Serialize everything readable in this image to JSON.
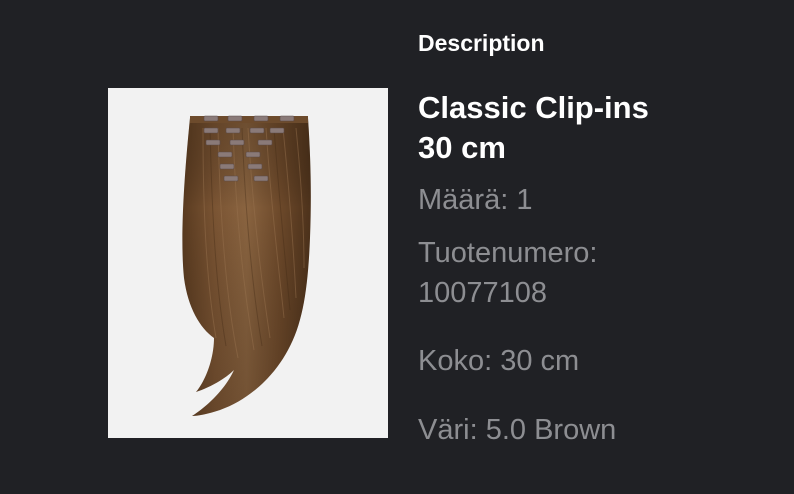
{
  "description_heading": "Description",
  "product": {
    "title_line1": "Classic Clip-ins",
    "title_line2": "30 cm",
    "image_alt": "Brown clip-in hair extensions"
  },
  "attributes": {
    "quantity_label": "Määrä:",
    "quantity_value": "1",
    "sku_label": "Tuotenumero:",
    "sku_value": "10077108",
    "size_label": "Koko:",
    "size_value": "30 cm",
    "color_label": "Väri:",
    "color_value": "5.0 Brown"
  },
  "colors": {
    "background": "#202125",
    "text_primary": "#ffffff",
    "text_secondary": "#8d8e92",
    "image_background": "#f2f2f2",
    "hair_brown": "#6b4a2a"
  }
}
